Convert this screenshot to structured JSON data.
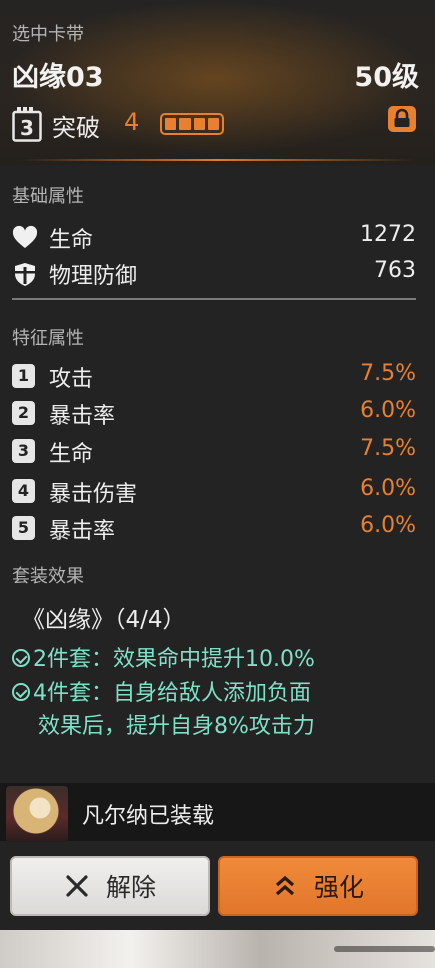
{
  "header": {
    "section_label": "选中卡带",
    "title": "凶缘03",
    "level": "50级",
    "tier_icon_label": "3",
    "breakthrough_label": "突破",
    "breakthrough_value": "4",
    "breakthrough_progress": "4/4",
    "icons": [
      "tier-icon",
      "lock-icon"
    ],
    "accent_color": "#e8802f"
  },
  "base": {
    "label": "基础属性",
    "items": [
      {
        "icon": "heart-icon",
        "name": "生命",
        "value": "1272"
      },
      {
        "icon": "shield-icon",
        "name": "物理防御",
        "value": "763"
      }
    ]
  },
  "traits": {
    "label": "特征属性",
    "items": [
      {
        "num": "1",
        "name": "攻击",
        "value": "7.5%"
      },
      {
        "num": "2",
        "name": "暴击率",
        "value": "6.0%"
      },
      {
        "num": "3",
        "name": "生命",
        "value": "7.5%"
      },
      {
        "num": "4",
        "name": "暴击伤害",
        "value": "6.0%"
      },
      {
        "num": "5",
        "name": "暴击率",
        "value": "6.0%"
      }
    ]
  },
  "set": {
    "label": "套装效果",
    "title": "《凶缘》（4/4）",
    "line1": "2件套：效果命中提升10.0%",
    "line2": "4件套：自身给敌人添加负面",
    "line3": "效果后，提升自身8%攻击力",
    "effect_color": "#7fe0c8"
  },
  "equip": {
    "text": "凡尔纳已装载"
  },
  "buttons": {
    "remove_label": "解除",
    "enhance_label": "强化"
  }
}
